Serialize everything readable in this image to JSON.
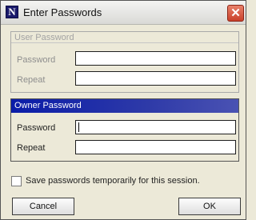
{
  "window": {
    "title": "Enter Passwords",
    "app_icon_glyph": "N",
    "close_glyph": "✕"
  },
  "user_password": {
    "header": "User Password",
    "password_label": "Password",
    "password_value": "",
    "repeat_label": "Repeat",
    "repeat_value": ""
  },
  "owner_password": {
    "header": "Owner Password",
    "password_label": "Password",
    "password_value": "",
    "repeat_label": "Repeat",
    "repeat_value": ""
  },
  "options": {
    "save_label": "Save passwords temporarily for this session.",
    "save_checked": false
  },
  "buttons": {
    "cancel_label": "Cancel",
    "ok_label": "OK"
  },
  "colors": {
    "owner_header_start": "#0a1ca8",
    "owner_header_end": "#4a52b3",
    "disabled_text": "#8e8e8e",
    "close_button": "#c9402a"
  }
}
